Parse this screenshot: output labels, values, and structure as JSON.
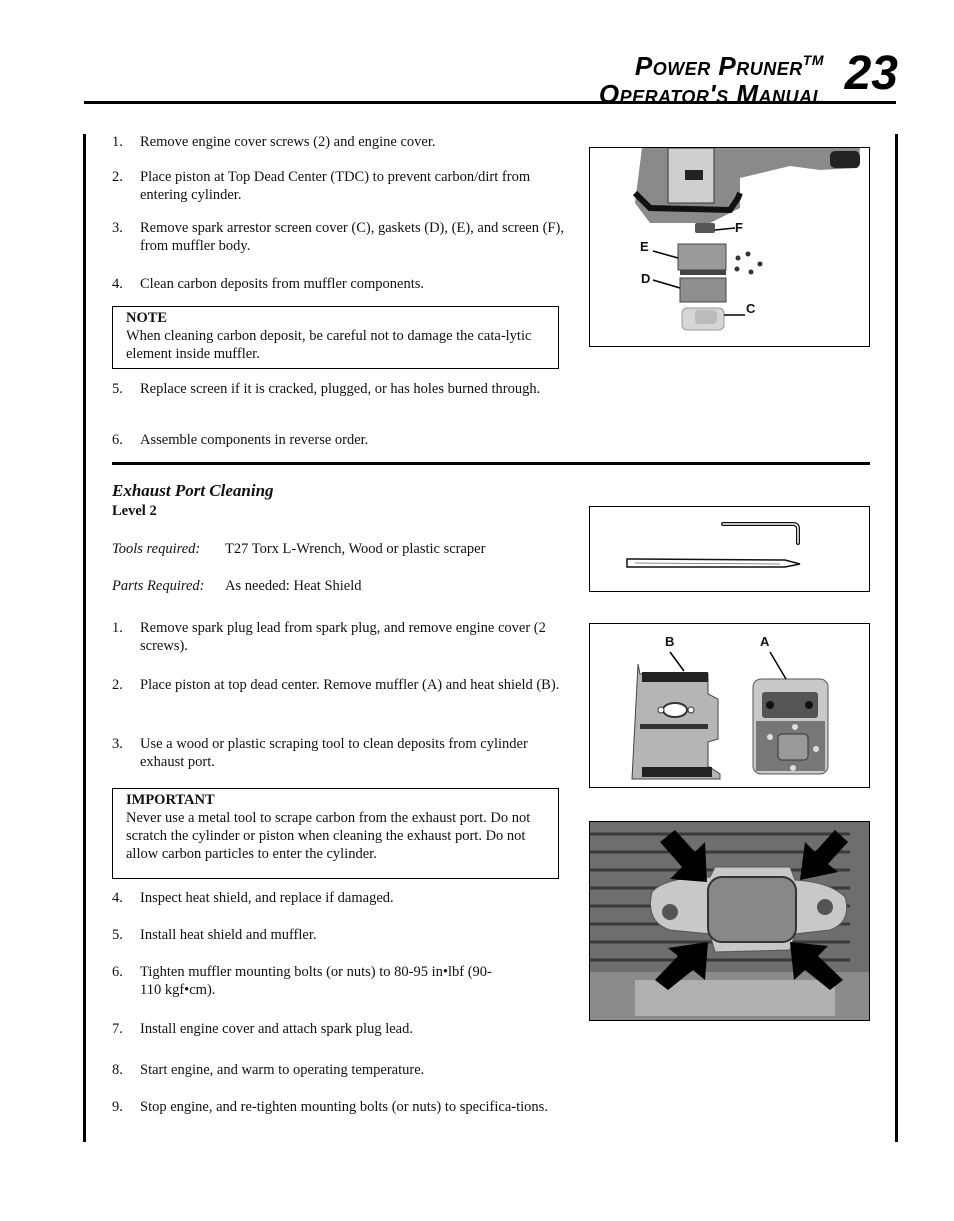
{
  "header": {
    "title_line1": "Power Pruner",
    "trademark": "TM",
    "title_line2": "Operator's Manual",
    "page_number": "23"
  },
  "muffler_section": {
    "steps": [
      {
        "num": "1.",
        "text": "Remove engine cover screws (2) and engine cover."
      },
      {
        "num": "2.",
        "text": "Place piston at Top Dead Center (TDC) to prevent carbon/dirt from entering cylinder."
      },
      {
        "num": "3.",
        "text": "Remove spark arrestor screen cover (C), gaskets (D), (E), and screen (F), from muffler body."
      },
      {
        "num": "4.",
        "text": "Clean carbon deposits from muffler components."
      },
      {
        "num": "5.",
        "text": "Replace screen if it is cracked, plugged, or has holes burned through."
      },
      {
        "num": "6.",
        "text": "Assemble components in reverse order."
      }
    ],
    "note": {
      "title": "NOTE",
      "text": "When cleaning carbon deposit, be careful not to damage the cata-lytic element inside muffler."
    },
    "figure": {
      "callouts": [
        "F",
        "E",
        "D",
        "C"
      ]
    }
  },
  "exhaust_section": {
    "title": "Exhaust Port Cleaning",
    "level": "Level 2",
    "tools_label": "Tools required:",
    "tools_value": "T27 Torx L-Wrench, Wood or plastic scraper",
    "parts_label": "Parts Required:",
    "parts_value": "As needed: Heat Shield",
    "steps": [
      {
        "num": "1.",
        "text": "Remove spark plug lead from spark plug, and remove engine cover (2 screws)."
      },
      {
        "num": "2.",
        "text": "Place piston at top dead center. Remove muffler (A) and heat shield (B)."
      },
      {
        "num": "3.",
        "text": "Use a wood or plastic scraping tool to clean deposits from cylinder exhaust port."
      },
      {
        "num": "4.",
        "text": "Inspect heat shield, and replace if damaged."
      },
      {
        "num": "5.",
        "text": "Install heat shield and muffler."
      },
      {
        "num": "6.",
        "text": "Tighten muffler mounting bolts (or nuts) to 80-95 in•lbf (90-110 kgf•cm)."
      },
      {
        "num": "7.",
        "text": "Install engine cover and attach spark plug lead."
      },
      {
        "num": "8.",
        "text": "Start engine, and warm to operating temperature."
      },
      {
        "num": "9.",
        "text": "Stop engine, and re-tighten mounting bolts (or nuts) to specifica-tions."
      }
    ],
    "important": {
      "title": "IMPORTANT",
      "text": "Never use a metal tool to scrape carbon from the exhaust port. Do not scratch the cylinder or piston when cleaning the exhaust port. Do not allow carbon particles to enter the cylinder."
    },
    "figure_parts": {
      "callouts": [
        "B",
        "A"
      ]
    }
  }
}
